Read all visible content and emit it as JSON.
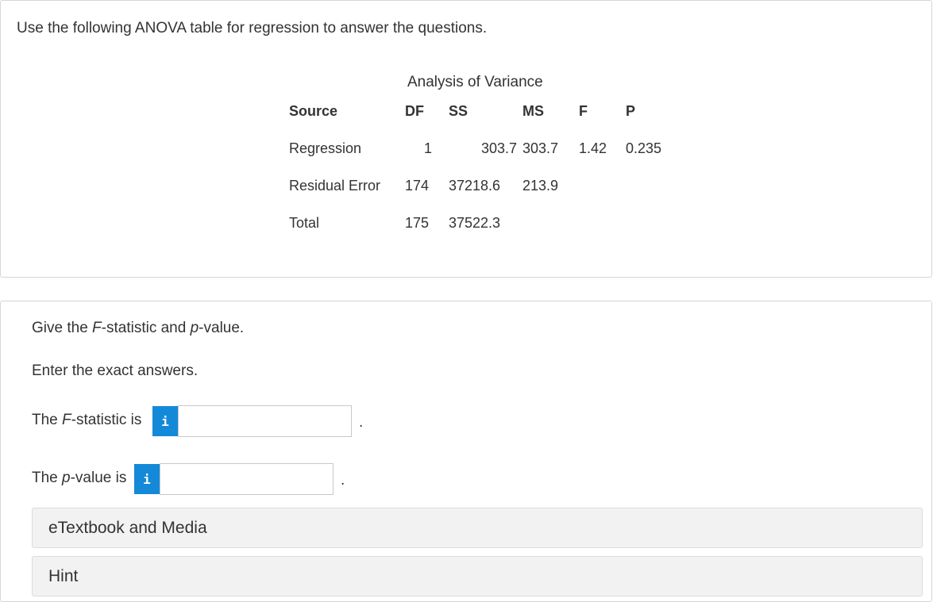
{
  "intro": "Use the following ANOVA table for regression to answer the questions.",
  "anova": {
    "title": "Analysis of Variance",
    "headers": {
      "source": "Source",
      "df": "DF",
      "ss": "SS",
      "ms": "MS",
      "f": "F",
      "p": "P"
    },
    "rows": [
      {
        "source": "Regression",
        "df": "1",
        "ss": "303.7",
        "ms": "303.7",
        "f": "1.42",
        "p": "0.235"
      },
      {
        "source": "Residual Error",
        "df": "174",
        "ss": "37218.6",
        "ms": "213.9",
        "f": "",
        "p": ""
      },
      {
        "source": "Total",
        "df": "175",
        "ss": "37522.3",
        "ms": "",
        "f": "",
        "p": ""
      }
    ]
  },
  "question": {
    "prompt_prefix": "Give the ",
    "prompt_f": "F",
    "prompt_mid": "-statistic and ",
    "prompt_p": "p",
    "prompt_suffix": "-value.",
    "instruction": "Enter the exact answers."
  },
  "answers": {
    "f_label_prefix": "The ",
    "f_label_var": "F",
    "f_label_suffix": "-statistic is",
    "f_value": "",
    "p_label_prefix": "The ",
    "p_label_var": "p",
    "p_label_suffix": "-value is",
    "p_value": "",
    "period": ".",
    "info_glyph": "i"
  },
  "accordions": {
    "etextbook": "eTextbook and Media",
    "hint": "Hint"
  },
  "colors": {
    "info_button": "#1489d8",
    "accordion_bg": "#f2f2f2"
  }
}
